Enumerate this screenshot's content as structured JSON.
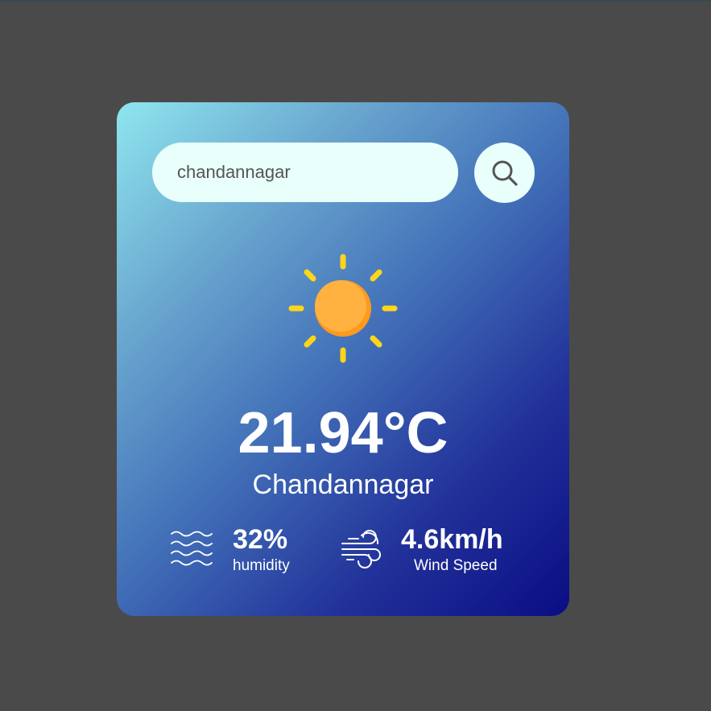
{
  "search": {
    "value": "chandannagar",
    "icon": "search-icon"
  },
  "weather": {
    "icon": "sun-icon",
    "temperature": "21.94°C",
    "city": "Chandannagar"
  },
  "humidity": {
    "icon": "humidity-waves-icon",
    "value": "32%",
    "label": "humidity"
  },
  "wind": {
    "icon": "wind-icon",
    "value": "4.6km/h",
    "label": "Wind Speed"
  },
  "colors": {
    "background": "#4a4a4a",
    "card_gradient_start": "#8fe6ef",
    "card_gradient_end": "#0a0d84",
    "input_background": "#e9fffb",
    "sun_core": "#ffac38",
    "sun_rays": "#ffd51a",
    "text": "#ffffff"
  }
}
